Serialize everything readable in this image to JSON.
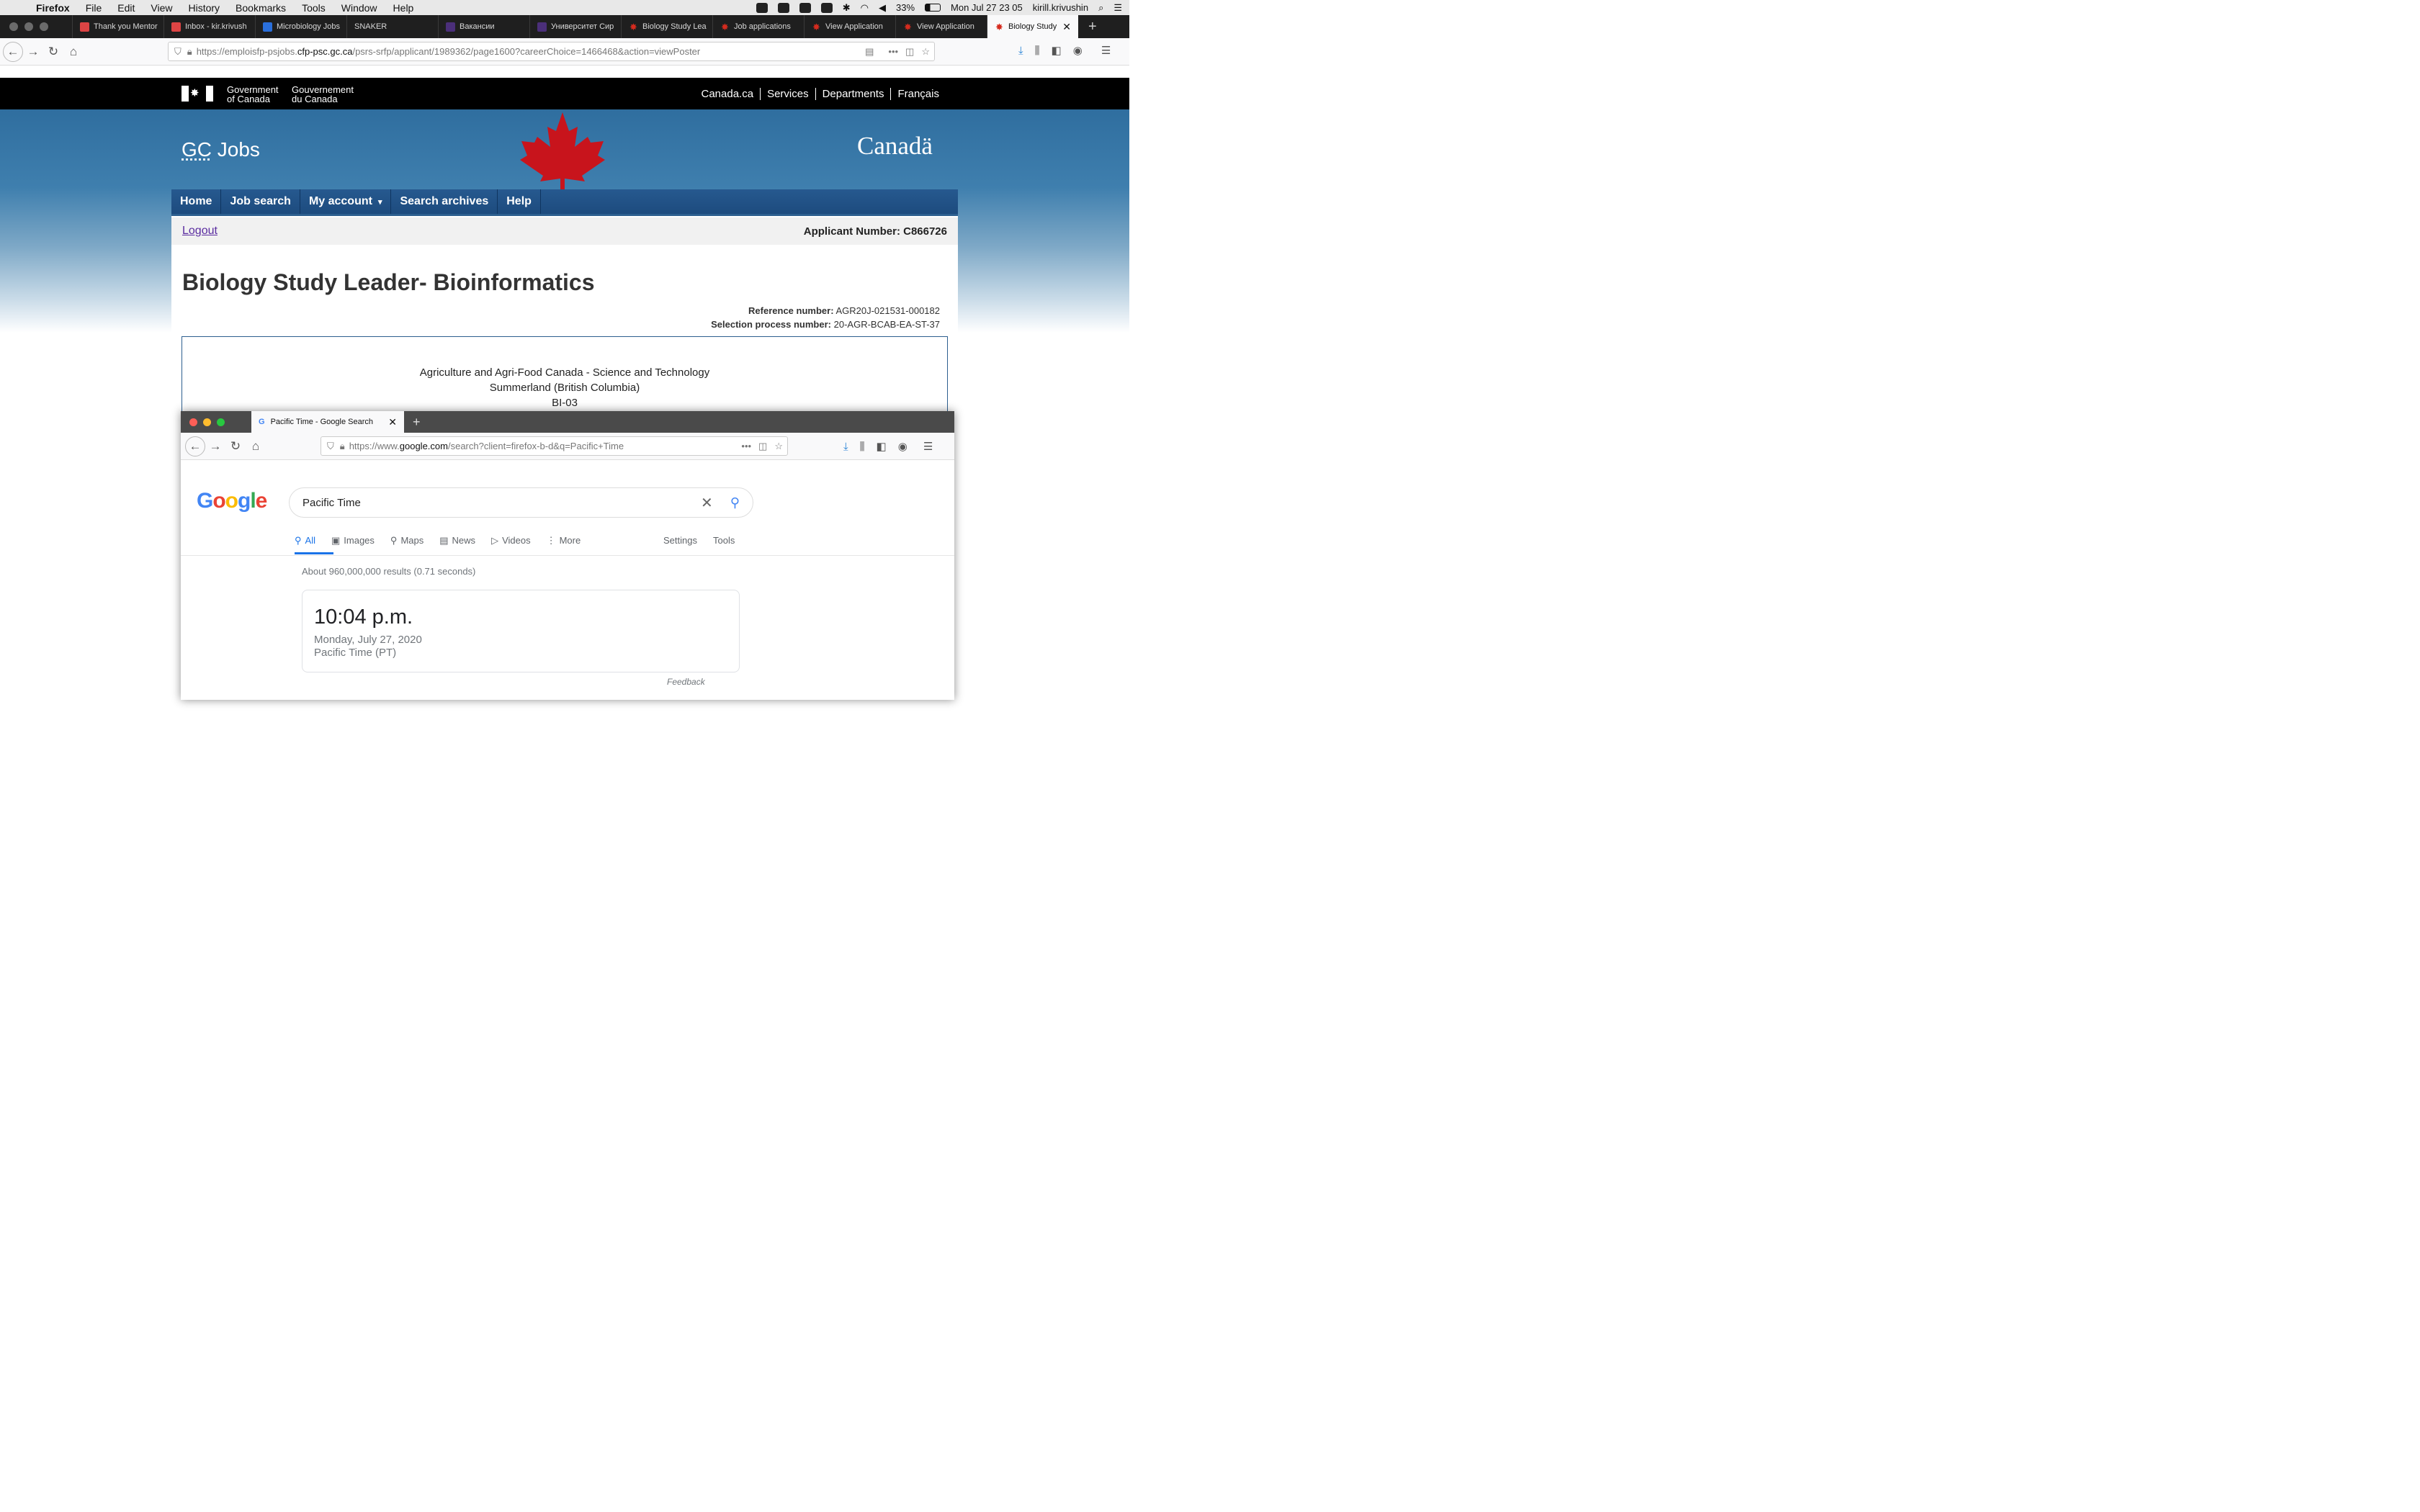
{
  "menubar": {
    "app": "Firefox",
    "items": [
      "File",
      "Edit",
      "View",
      "History",
      "Bookmarks",
      "Tools",
      "Window",
      "Help"
    ],
    "battery": "33%",
    "datetime": "Mon Jul 27  23 05",
    "user": "kirill.krivushin"
  },
  "tabs": [
    {
      "label": "Thank you Mentor",
      "icon": "gmail-icon"
    },
    {
      "label": "Inbox - kir.krivush",
      "icon": "gmail-icon"
    },
    {
      "label": "Microbiology Jobs",
      "icon": "info-icon"
    },
    {
      "label": "SNAKER",
      "icon": ""
    },
    {
      "label": "Вакансии",
      "icon": "site-icon"
    },
    {
      "label": "Университет Сир",
      "icon": "site-icon"
    },
    {
      "label": "Biology Study Lea",
      "icon": "maple-leaf-icon"
    },
    {
      "label": "Job applications",
      "icon": "maple-leaf-icon"
    },
    {
      "label": "View Application",
      "icon": "maple-leaf-icon"
    },
    {
      "label": "View Application",
      "icon": "maple-leaf-icon"
    },
    {
      "label": "Biology Study",
      "icon": "maple-leaf-icon",
      "active": true
    }
  ],
  "url": {
    "prefix": "https://emploisfp-psjobs.",
    "host": "cfp-psc.gc.ca",
    "path": "/psrs-srfp/applicant/1989362/page1600?careerChoice=1466468&action=viewPoster"
  },
  "gc": {
    "gov_en_1": "Government",
    "gov_en_2": "of Canada",
    "gov_fr_1": "Gouvernement",
    "gov_fr_2": "du Canada",
    "nav": [
      "Canada.ca",
      "Services",
      "Departments",
      "Français"
    ],
    "site_title_1": "GC",
    "site_title_2": " Jobs",
    "wordmark": "Canadä",
    "menu": [
      "Home",
      "Job search",
      "My account",
      "Search archives",
      "Help"
    ],
    "logout": "Logout",
    "applicant_number": "Applicant Number: C866726",
    "job_title": "Biology Study Leader- Bioinformatics",
    "reference_label": "Reference number:",
    "reference_value": "AGR20J-021531-000182",
    "selection_label": "Selection process number:",
    "selection_value": "20-AGR-BCAB-EA-ST-37",
    "department": "Agriculture and Agri-Food Canada - Science and Technology",
    "location": "Summerland (British Columbia)",
    "classification": "BI-03"
  },
  "win2": {
    "tab_title": "Pacific Time - Google Search",
    "url_prefix": "https://www.",
    "url_host": "google.com",
    "url_path": "/search?client=firefox-b-d&q=Pacific+Time",
    "query": "Pacific Time",
    "tabs": [
      "All",
      "Images",
      "Maps",
      "News",
      "Videos",
      "More"
    ],
    "right_tabs": [
      "Settings",
      "Tools"
    ],
    "result_count": "About 960,000,000 results (0.71 seconds)",
    "time": "10:04 p.m.",
    "date": "Monday, July 27, 2020",
    "zone": "Pacific Time (PT)",
    "feedback": "Feedback"
  }
}
